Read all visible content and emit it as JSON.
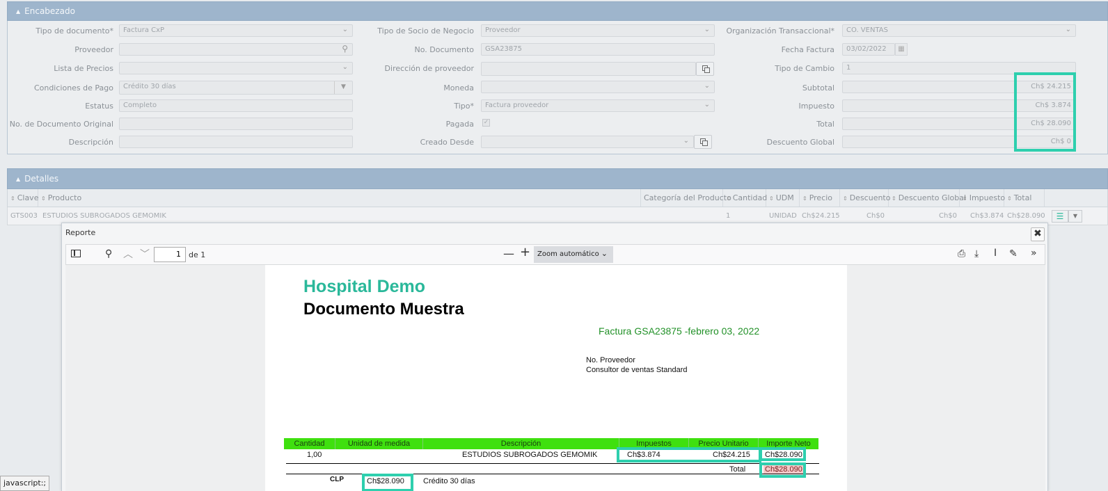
{
  "header_panel": {
    "title": "Encabezado"
  },
  "fields": {
    "tipo_documento": {
      "label": "Tipo de documento*",
      "value": "Factura CxP"
    },
    "proveedor": {
      "label": "Proveedor",
      "value": ""
    },
    "lista_precios": {
      "label": "Lista de Precios",
      "value": ""
    },
    "condiciones_pago": {
      "label": "Condiciones de Pago",
      "value": "Crédito 30 días"
    },
    "estatus": {
      "label": "Estatus",
      "value": "Completo"
    },
    "doc_original": {
      "label": "No. de Documento Original",
      "value": ""
    },
    "descripcion": {
      "label": "Descripción",
      "value": ""
    },
    "tipo_socio": {
      "label": "Tipo de Socio de Negocio",
      "value": "Proveedor"
    },
    "no_documento": {
      "label": "No. Documento",
      "value": "GSA23875"
    },
    "direccion": {
      "label": "Dirección de proveedor",
      "value": ""
    },
    "moneda": {
      "label": "Moneda",
      "value": ""
    },
    "tipo": {
      "label": "Tipo*",
      "value": "Factura proveedor"
    },
    "pagada": {
      "label": "Pagada",
      "checked": true
    },
    "creado_desde": {
      "label": "Creado Desde",
      "value": ""
    },
    "org": {
      "label": "Organización Transaccional*",
      "value": "CO. VENTAS"
    },
    "fecha": {
      "label": "Fecha Factura",
      "value": "03/02/2022"
    },
    "tipo_cambio": {
      "label": "Tipo de Cambio",
      "value": "1"
    },
    "subtotal": {
      "label": "Subtotal",
      "value": "Ch$ 24.215"
    },
    "impuesto": {
      "label": "Impuesto",
      "value": "Ch$ 3.874"
    },
    "total": {
      "label": "Total",
      "value": "Ch$ 28.090"
    },
    "descuento_global": {
      "label": "Descuento Global",
      "value": "Ch$ 0"
    }
  },
  "details_panel": {
    "title": "Detalles",
    "columns": [
      "Clave",
      "Producto",
      "Categoría del Producto",
      "Cantidad",
      "UDM",
      "Precio",
      "Descuento",
      "Descuento Global",
      "Impuesto",
      "Total"
    ],
    "row": {
      "clave": "GTS003",
      "producto": "ESTUDIOS SUBROGADOS GEMOMIK",
      "categoria": "",
      "cantidad": "1",
      "udm": "UNIDAD",
      "precio": "Ch$24.215",
      "descuento": "Ch$0",
      "descuento_global": "Ch$0",
      "impuesto": "Ch$3.874",
      "total": "Ch$28.090"
    }
  },
  "modal": {
    "title": "Reporte",
    "close_glyph": "✖",
    "viewer": {
      "page": "1",
      "page_of": "de 1",
      "zoom": "Zoom automático"
    },
    "report": {
      "company": "Hospital Demo",
      "doc_title": "Documento Muestra",
      "invoice_line": "Factura  GSA23875 -febrero 03, 2022",
      "provider_label": "No. Proveedor",
      "provider_name": "Consultor de ventas Standard",
      "table_headers": [
        "Cantidad",
        "Unidad de medida",
        "Descripción",
        "Impuestos",
        "Precio Unitario",
        "Importe Neto"
      ],
      "row": {
        "cantidad": "1,00",
        "unidad": "",
        "descripcion": "ESTUDIOS SUBROGADOS GEMOMIK",
        "impuestos": "Ch$3.874",
        "precio": "Ch$24.215",
        "importe": "Ch$28.090"
      },
      "total_label": "Total",
      "total_value": "Ch$28.090",
      "currency": "CLP",
      "currency_amount": "Ch$28.090",
      "terms": "Crédito 30 días"
    }
  },
  "status_bar": {
    "text": "javascript:;"
  },
  "colors": {
    "panel_header": "#9eb5cc",
    "highlight": "#2ecfae",
    "report_green": "#3fe00f",
    "title_green": "#2ab89a"
  }
}
